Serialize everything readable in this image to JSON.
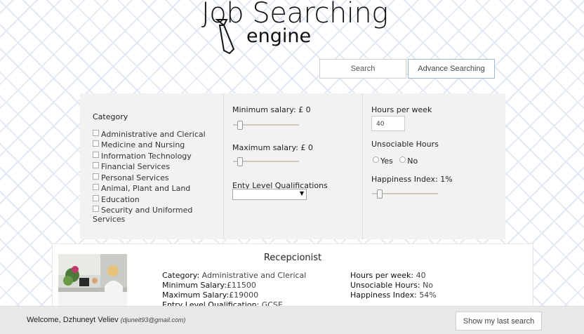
{
  "logo": {
    "line1": "Job Searching",
    "line2": "engine"
  },
  "tabs": {
    "search": "Search",
    "advanced": "Advance Searching"
  },
  "filters": {
    "category_label": "Category",
    "categories": [
      "Administrative and Clerical",
      "Medicine and Nursing",
      "Information Technology",
      "Financial Services",
      "Personal Services",
      "Animal, Plant and Land",
      "Education",
      "Security and Uniformed",
      "Services"
    ],
    "min_salary_label": "Minimum salary: £ 0",
    "min_salary_level": 0,
    "max_salary_label": "Maximum salary: £ 0",
    "max_salary_level": 0,
    "entry_qual_label": "Enty Level Qualifications",
    "entry_qual_selected": "",
    "hours_label": "Hours per week",
    "hours_value": "40",
    "unsociable_label": "Unsociable Hours",
    "radio_yes": "Yes",
    "radio_no": "No",
    "happiness_label": "Happiness Index: 1%",
    "happiness_level": 0.01
  },
  "result": {
    "title": "Recepcionist",
    "left": [
      {
        "k": "Category:",
        "v": "Administrative and Clerical"
      },
      {
        "k": "Minimum Salary:",
        "v": "£11500"
      },
      {
        "k": "Maximum Salary:",
        "v": "£19000"
      },
      {
        "k": "Entry Level Qualification:",
        "v": "GCSE"
      }
    ],
    "right": [
      {
        "k": "Hours per week:",
        "v": "40"
      },
      {
        "k": "Unsociable Hours:",
        "v": "No"
      },
      {
        "k": "Happiness Index:",
        "v": "54%"
      }
    ]
  },
  "footer": {
    "welcome": "Welcome, Dzhuneyt Veliev",
    "email": "(djuneit93@gmail.com)",
    "last_search_button": "Show my last search"
  }
}
